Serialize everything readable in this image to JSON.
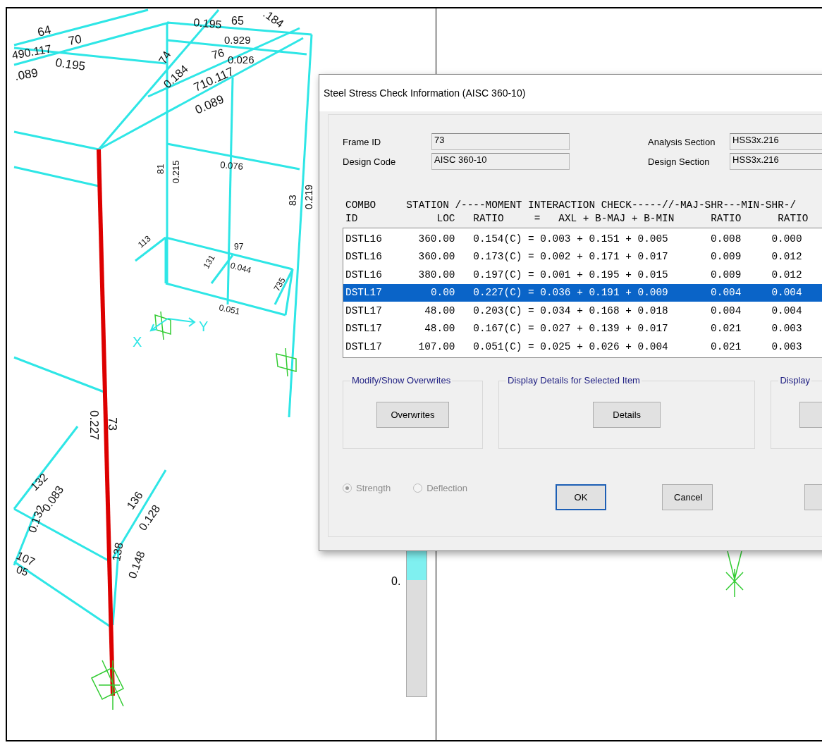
{
  "model_view": {
    "member_labels": [
      "64",
      "70",
      "490.117",
      "0.195",
      ".089",
      "0.195",
      "65",
      ".184",
      "0.929",
      "74",
      "0.184",
      "76",
      "0.026",
      "710.117",
      "0.089",
      "81",
      "0.215",
      "0.076",
      "83",
      "0.219",
      "113",
      "97",
      "131",
      "0.044",
      "0.051",
      "735",
      "0.227",
      "73",
      "132",
      "0.083",
      "0.132",
      "107",
      "05",
      "136",
      "0.128",
      "138",
      "0.148"
    ],
    "axes": [
      "X",
      "Y"
    ],
    "legend_label": "0."
  },
  "dialog": {
    "title": "Steel Stress Check Information (AISC 360-10)",
    "fields": [
      {
        "label": "Frame ID",
        "value": "73"
      },
      {
        "label": "Analysis Section",
        "value": "HSS3x.216"
      },
      {
        "label": "Design Code",
        "value": "AISC 360-10"
      },
      {
        "label": "Design Section",
        "value": "HSS3x.216"
      }
    ],
    "table": {
      "header_lines": [
        "COMBO     STATION /----MOMENT INTERACTION CHECK-----//-MAJ-SHR---MIN-SHR-/",
        "ID             LOC   RATIO     =   AXL + B-MAJ + B-MIN      RATIO      RATIO"
      ],
      "rows": [
        {
          "cells": [
            "DSTL16",
            "360.00",
            "0.154(C) = 0.003 + 0.151 + 0.005",
            "0.008",
            "0.000"
          ],
          "selected": false
        },
        {
          "cells": [
            "DSTL16",
            "360.00",
            "0.173(C) = 0.002 + 0.171 + 0.017",
            "0.009",
            "0.012"
          ],
          "selected": false
        },
        {
          "cells": [
            "DSTL16",
            "380.00",
            "0.197(C) = 0.001 + 0.195 + 0.015",
            "0.009",
            "0.012"
          ],
          "selected": false
        },
        {
          "cells": [
            "DSTL17",
            "0.00",
            "0.227(C) = 0.036 + 0.191 + 0.009",
            "0.004",
            "0.004"
          ],
          "selected": true
        },
        {
          "cells": [
            "DSTL17",
            "48.00",
            "0.203(C) = 0.034 + 0.168 + 0.018",
            "0.004",
            "0.004"
          ],
          "selected": false
        },
        {
          "cells": [
            "DSTL17",
            "48.00",
            "0.167(C) = 0.027 + 0.139 + 0.017",
            "0.021",
            "0.003"
          ],
          "selected": false
        },
        {
          "cells": [
            "DSTL17",
            "107.00",
            "0.051(C) = 0.025 + 0.026 + 0.004",
            "0.021",
            "0.003"
          ],
          "selected": false
        }
      ]
    },
    "groups": [
      {
        "legend": "Modify/Show Overwrites",
        "button": "Overwrites"
      },
      {
        "legend": "Display Details for Selected Item",
        "button": "Details"
      },
      {
        "legend": "Display",
        "has_button": true
      }
    ],
    "options": [
      {
        "label": "Strength",
        "selected": true,
        "disabled": true
      },
      {
        "label": "Deflection",
        "selected": false,
        "disabled": true
      }
    ],
    "buttons": [
      {
        "label": "OK",
        "default": true
      },
      {
        "label": "Cancel",
        "default": false
      },
      {
        "default": false
      }
    ]
  }
}
